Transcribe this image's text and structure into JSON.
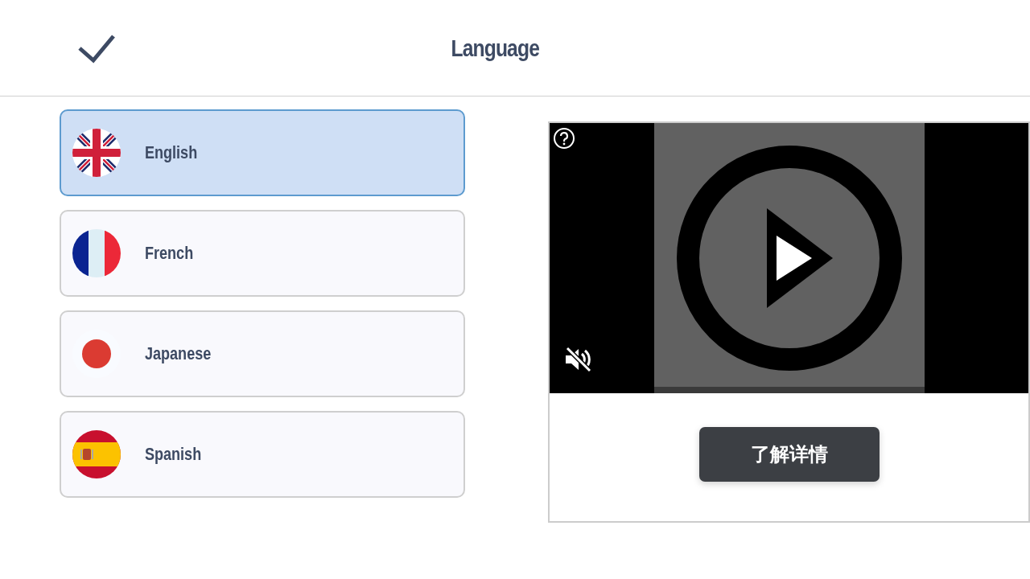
{
  "header": {
    "title": "Language"
  },
  "languages": [
    {
      "label": "English",
      "selected": true
    },
    {
      "label": "French",
      "selected": false
    },
    {
      "label": "Japanese",
      "selected": false
    },
    {
      "label": "Spanish",
      "selected": false
    }
  ],
  "ad": {
    "button": "了解详情"
  }
}
